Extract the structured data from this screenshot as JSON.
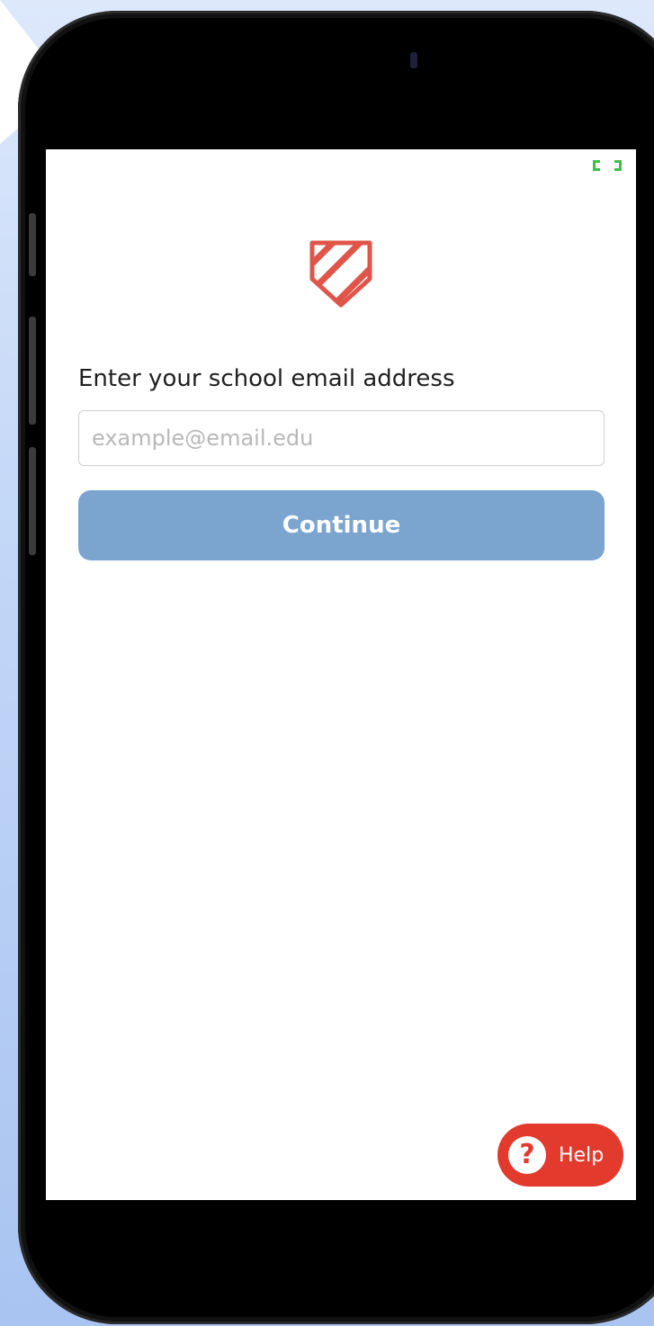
{
  "login": {
    "email_label": "Enter your school email address",
    "email_placeholder": "example@email.edu",
    "email_value": "",
    "continue_label": "Continue"
  },
  "help": {
    "icon_glyph": "?",
    "label": "Help"
  },
  "icons": {
    "logo": "striped-shield-icon",
    "expand": "expand-icon",
    "help": "question-circle-icon"
  },
  "colors": {
    "brand_red": "#e23a2c",
    "continue_button": "#7ba4cf",
    "logo_red": "#e0554a",
    "expand_green": "#3ac24a"
  }
}
